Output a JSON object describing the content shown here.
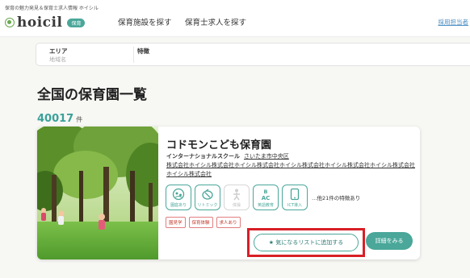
{
  "header": {
    "tagline": "保育の魅力発見＆保育士求人情報 ホイシル",
    "logo_text": "hoicil",
    "logo_badge": "保育",
    "nav": [
      "保育施設を探す",
      "保育士求人を探す"
    ],
    "right_link": "採用担当者"
  },
  "search": {
    "area_label": "エリア",
    "area_placeholder": "地域名",
    "feature_label": "特徴"
  },
  "page": {
    "title": "全国の保育園一覧",
    "count": "40017",
    "count_unit": "件"
  },
  "card": {
    "name": "コドモンこども保育園",
    "type": "インターナショナルスクール",
    "area": "さいたま市中央区",
    "operator": "株式会社ホイシル株式会社ホイシル株式会社ホイシル株式会社ホイシル株式会社ホイシル株式会社ホイシル株式会社",
    "features": [
      {
        "label": "園庭あり",
        "icon": "playground-icon",
        "enabled": true
      },
      {
        "label": "リトミック",
        "icon": "rhythmic-icon",
        "enabled": true
      },
      {
        "label": "体操",
        "icon": "gym-icon",
        "enabled": false
      },
      {
        "label": "英語教育",
        "icon": "abc-icon",
        "enabled": true
      },
      {
        "label": "ICT導入",
        "icon": "tablet-icon",
        "enabled": true
      }
    ],
    "more_features": "…他21件の特徴あり",
    "tags": [
      "園見学",
      "保育体験",
      "求人あり"
    ],
    "favorite_button": "★ 気になるリストに追加する",
    "detail_button": "詳細をみる"
  },
  "colors": {
    "accent": "#4aa79a",
    "highlight": "#d81f26",
    "tag": "#c0392b"
  }
}
